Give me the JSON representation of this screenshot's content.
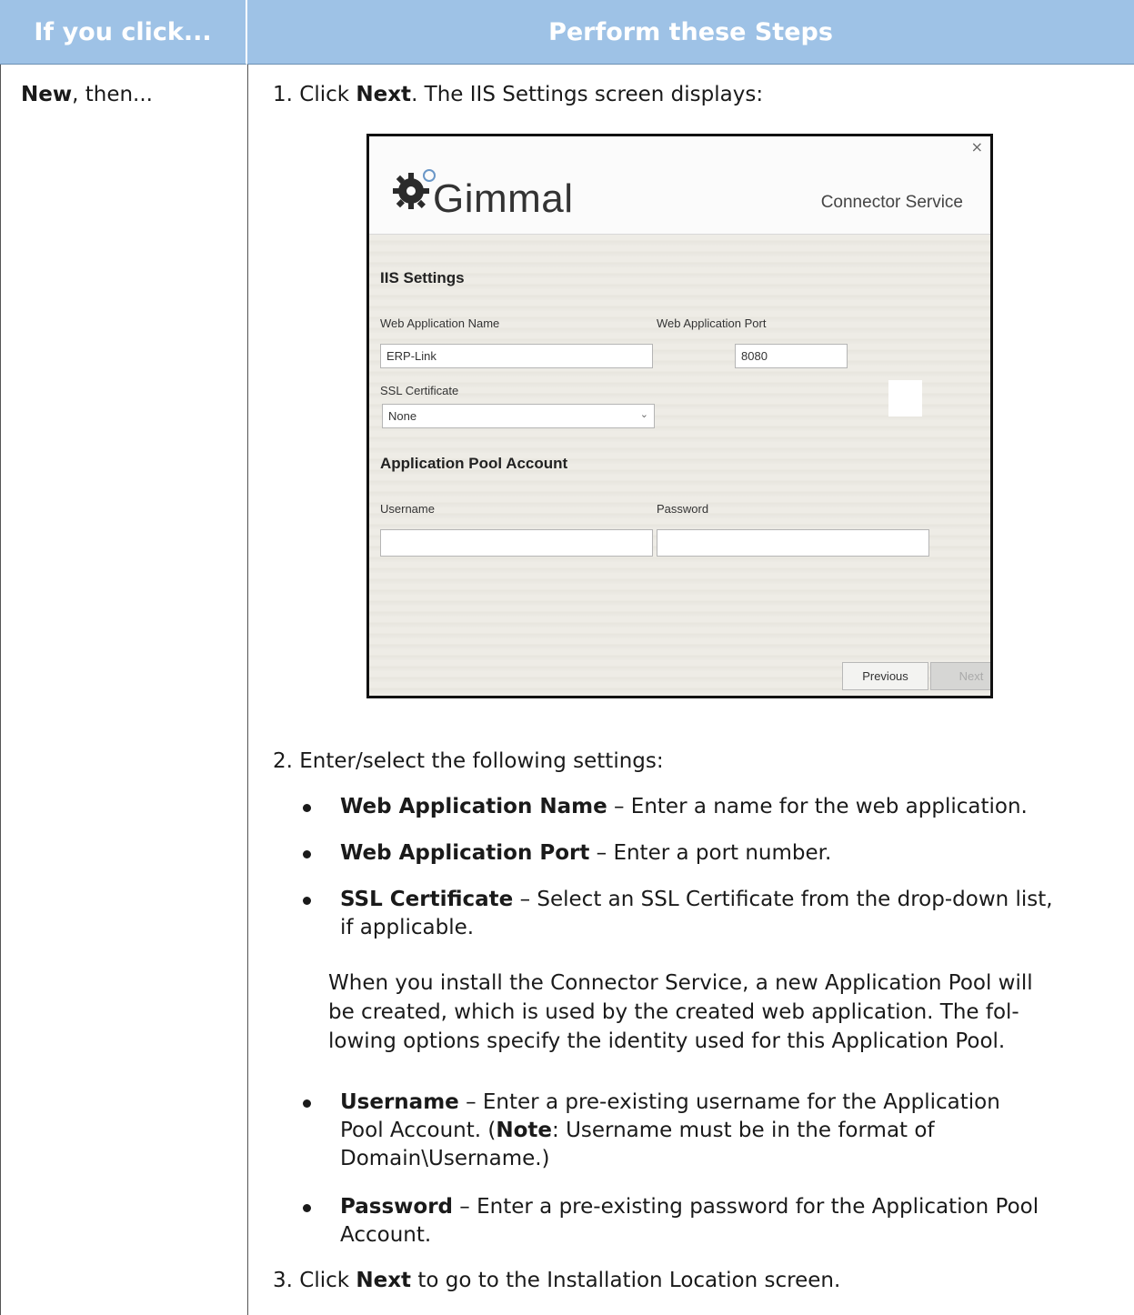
{
  "table": {
    "header_left": "If you click...",
    "header_right": "Perform these Steps",
    "left_cell_bold": "New",
    "left_cell_rest": ", then..."
  },
  "steps": {
    "step1_prefix": "1. Click ",
    "step1_bold": "Next",
    "step1_rest": ". The IIS Settings screen displays:",
    "step2": "2. Enter/select the following settings:",
    "step3_prefix": "3. Click ",
    "step3_bold": "Next",
    "step3_rest": " to go to the Installation Location screen."
  },
  "bullets": [
    {
      "bold": "Web Application Name",
      "rest": " – Enter a name for the web application."
    },
    {
      "bold": "Web Application Port",
      "rest": " –  Enter a port number."
    },
    {
      "bold": "SSL Certificate",
      "rest": " – Select an SSL Certificate from the drop-down list,",
      "rest2": "if applicable."
    }
  ],
  "paragraph": [
    "When you install the Connector Service, a new Application Pool will",
    "be created, which is used by the created web application. The fol-",
    "lowing options specify the identity used for this Application Pool."
  ],
  "bullets2": [
    {
      "bold": "Username",
      "lines": [
        " – Enter a pre-existing username for the Application",
        "Pool Account. (",
        "Note",
        ": Username must be in the format of",
        "Domain\\Username.)"
      ]
    },
    {
      "bold": "Password",
      "lines": [
        " – Enter a pre-existing password for the Application Pool",
        "Account."
      ]
    }
  ],
  "screenshot": {
    "close": "×",
    "logo": "Gimmal",
    "product": "Connector Service",
    "section_iis": "IIS Settings",
    "label_web_app_name": "Web Application Name",
    "label_web_app_port": "Web Application Port",
    "web_app_name_value": "ERP-Link",
    "web_app_port_value": "8080",
    "label_ssl": "SSL Certificate",
    "ssl_value": "None",
    "section_pool": "Application Pool Account",
    "label_username": "Username",
    "label_password": "Password",
    "username_value": "",
    "password_value": "",
    "btn_previous": "Previous",
    "btn_next": "Next"
  }
}
